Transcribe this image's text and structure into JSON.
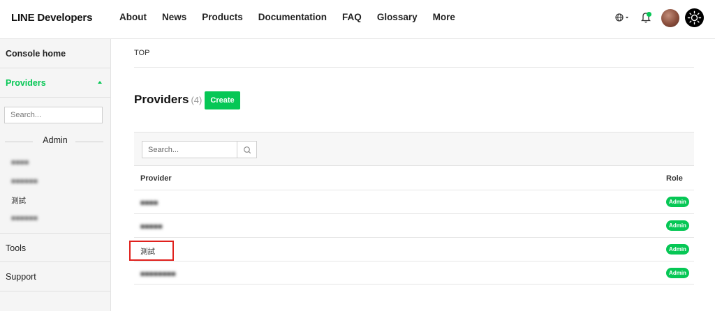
{
  "header": {
    "logo": "LINE Developers",
    "nav": [
      "About",
      "News",
      "Products",
      "Documentation",
      "FAQ",
      "Glossary",
      "More"
    ]
  },
  "sidebar": {
    "console_home": "Console home",
    "providers": "Providers",
    "search_placeholder": "Search...",
    "admin_heading": "Admin",
    "provider_list": [
      "■■■■",
      "■■■■■■",
      "測試",
      "■■■■■■"
    ],
    "tools": "Tools",
    "support": "Support"
  },
  "main": {
    "breadcrumb": "TOP",
    "title": "Providers",
    "count": "(4)",
    "create_label": "Create",
    "search_placeholder": "Search...",
    "columns": {
      "provider": "Provider",
      "role": "Role"
    },
    "rows": [
      {
        "provider": "■■■■",
        "role": "Admin"
      },
      {
        "provider": "■■■■■",
        "role": "Admin"
      },
      {
        "provider": "測試",
        "role": "Admin"
      },
      {
        "provider": "■■■■■■■■",
        "role": "Admin"
      }
    ]
  },
  "colors": {
    "accent": "#06c755",
    "highlight": "#e0201c"
  },
  "icons": [
    "globe-icon",
    "bell-icon",
    "avatar",
    "theme-toggle-icon",
    "search-icon",
    "caret-up-icon"
  ]
}
